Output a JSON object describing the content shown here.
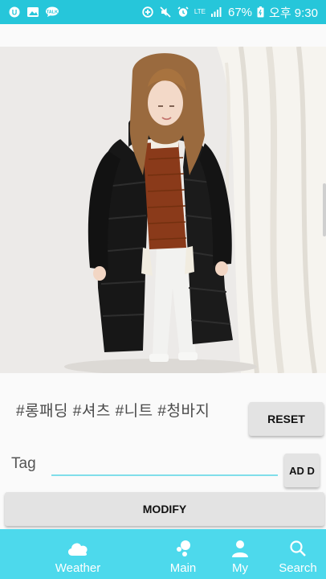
{
  "status_bar": {
    "battery": "67%",
    "time": "오후 9:30",
    "network": "LTE",
    "left_icons": [
      "kakao-icon",
      "gallery-icon",
      "talk-icon"
    ],
    "right_icons": [
      "data-saver-icon",
      "mute-icon",
      "alarm-icon",
      "signal-icon",
      "battery-icon"
    ]
  },
  "photo": {
    "description_icon": "fashion-photo"
  },
  "tags": {
    "text": "#롱패딩 #셔츠 #니트 #청바지",
    "reset_label": "RESET"
  },
  "tag_input": {
    "label": "Tag",
    "value": "",
    "placeholder": "",
    "add_label": "AD D"
  },
  "modify_label": "MODIFY",
  "bottom_nav": {
    "items": [
      {
        "label": "Weather",
        "icon": "cloud-icon"
      },
      {
        "label": "Main",
        "icon": "dots-icon"
      },
      {
        "label": "My",
        "icon": "person-icon"
      },
      {
        "label": "Search",
        "icon": "search-icon"
      }
    ]
  },
  "colors": {
    "status_bar": "#26c6da",
    "bottom_nav": "#4dd9ec",
    "input_underline": "#80deea",
    "button_bg": "#e3e3e3"
  }
}
